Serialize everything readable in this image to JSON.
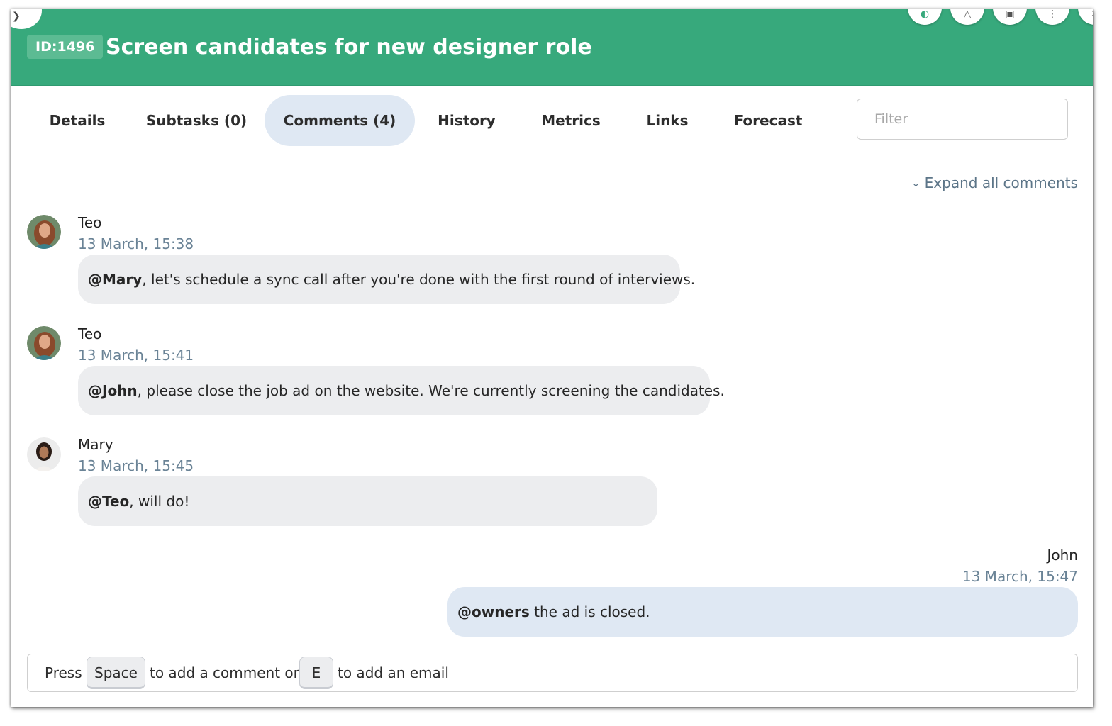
{
  "header": {
    "id_label": "ID:1496",
    "title": "Screen candidates for new designer role",
    "accent_color": "#37a97c",
    "action_icons": [
      "chevron-left-icon",
      "palette-icon",
      "bell-icon",
      "archive-icon",
      "more-icon",
      "close-icon"
    ]
  },
  "tabs": [
    {
      "label": "Details"
    },
    {
      "label": "Subtasks (0)"
    },
    {
      "label": "Comments (4)",
      "active": true
    },
    {
      "label": "History"
    },
    {
      "label": "Metrics"
    },
    {
      "label": "Links"
    },
    {
      "label": "Forecast"
    }
  ],
  "filter": {
    "placeholder": "Filter",
    "value": ""
  },
  "expand_label": "Expand all comments",
  "comments": [
    {
      "author": "Teo",
      "timestamp": "13 March, 15:38",
      "mention": "@Mary",
      "text": ", let's schedule a sync call after you're done with the first round of interviews."
    },
    {
      "author": "Teo",
      "timestamp": "13 March, 15:41",
      "mention": "@John",
      "text": ", please close the job ad on the website. We're currently screening the candidates."
    },
    {
      "author": "Mary",
      "timestamp": "13 March, 15:45",
      "mention": "@Teo",
      "text": ", will do!"
    },
    {
      "author": "John",
      "timestamp": "13 March, 15:47",
      "mention": "@owners",
      "text": " the ad is closed."
    }
  ],
  "composer": {
    "press": "Press",
    "key_space": "Space",
    "middle": "to add a comment or",
    "key_e": "E",
    "end": "to add an email"
  }
}
